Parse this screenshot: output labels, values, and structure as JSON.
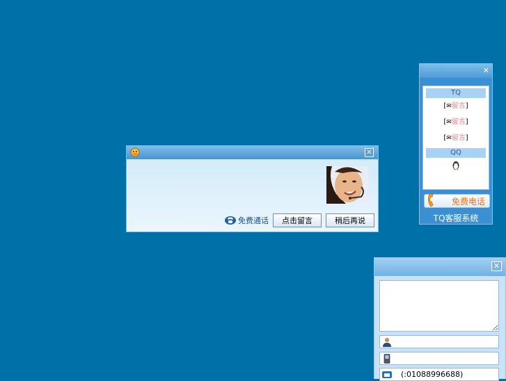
{
  "invite_dialog": {
    "free_call_label": "免费通话",
    "leave_message_button": "点击留言",
    "later_button": "稍后再说",
    "close_glyph": "✕"
  },
  "float_panel": {
    "close_glyph": "✕",
    "tq_section": "TQ",
    "items": [
      {
        "open": "[",
        "icon": "✉",
        "label": "留言",
        "close": "]"
      },
      {
        "open": "[",
        "icon": "✉",
        "label": "留言",
        "close": "]"
      },
      {
        "open": "[",
        "icon": "✉",
        "label": "留言",
        "close": "]"
      }
    ],
    "qq_section": "QQ",
    "free_phone_button": "免费电话",
    "brand": "TQ客服系统"
  },
  "message_box": {
    "close_glyph": "✕",
    "phone_value": "(:01088996688)"
  }
}
